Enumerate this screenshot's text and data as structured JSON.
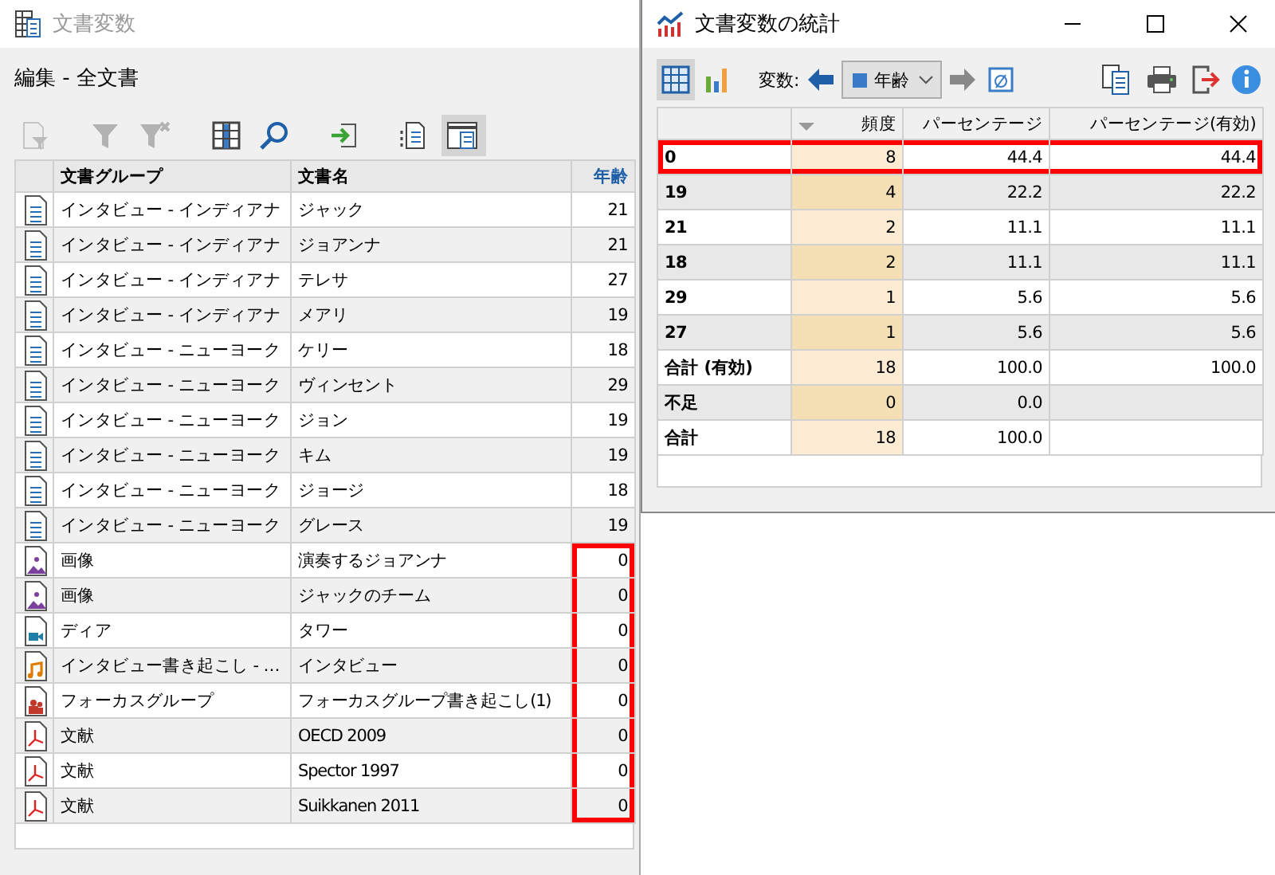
{
  "documents_window": {
    "title": "文書変数",
    "subtitle": "編集 - 全文書",
    "toolbar": [
      {
        "kind": "doc-filter",
        "disabled": true,
        "selected": false
      },
      {
        "kind": "filter",
        "disabled": true,
        "selected": false
      },
      {
        "kind": "filter-clear",
        "disabled": true,
        "selected": false
      },
      {
        "kind": "columns",
        "disabled": false,
        "selected": false
      },
      {
        "kind": "search",
        "disabled": false,
        "selected": false
      },
      {
        "kind": "import",
        "disabled": false,
        "selected": false
      },
      {
        "kind": "doc-list",
        "disabled": false,
        "selected": false
      },
      {
        "kind": "doc-panel",
        "disabled": false,
        "selected": true
      }
    ],
    "table": {
      "columns": [
        "文書グループ",
        "文書名",
        "年齢"
      ],
      "rows": [
        {
          "kind": "text",
          "group": "インタビュー - インディアナ",
          "name": "ジャック",
          "age": "21",
          "age_highlighted": false
        },
        {
          "kind": "text",
          "group": "インタビュー - インディアナ",
          "name": "ジョアンナ",
          "age": "21",
          "age_highlighted": false
        },
        {
          "kind": "text",
          "group": "インタビュー - インディアナ",
          "name": "テレサ",
          "age": "27",
          "age_highlighted": false
        },
        {
          "kind": "text",
          "group": "インタビュー - インディアナ",
          "name": "メアリ",
          "age": "19",
          "age_highlighted": false
        },
        {
          "kind": "text",
          "group": "インタビュー - ニューヨーク",
          "name": "ケリー",
          "age": "18",
          "age_highlighted": false
        },
        {
          "kind": "text",
          "group": "インタビュー - ニューヨーク",
          "name": "ヴィンセント",
          "age": "29",
          "age_highlighted": false
        },
        {
          "kind": "text",
          "group": "インタビュー - ニューヨーク",
          "name": "ジョン",
          "age": "19",
          "age_highlighted": false
        },
        {
          "kind": "text",
          "group": "インタビュー - ニューヨーク",
          "name": "キム",
          "age": "19",
          "age_highlighted": false
        },
        {
          "kind": "text",
          "group": "インタビュー - ニューヨーク",
          "name": "ジョージ",
          "age": "18",
          "age_highlighted": false
        },
        {
          "kind": "text",
          "group": "インタビュー - ニューヨーク",
          "name": "グレース",
          "age": "19",
          "age_highlighted": false
        },
        {
          "kind": "image",
          "group": "画像",
          "name": "演奏するジョアンナ",
          "age": "0",
          "age_highlighted": true
        },
        {
          "kind": "image",
          "group": "画像",
          "name": "ジャックのチーム",
          "age": "0",
          "age_highlighted": true
        },
        {
          "kind": "video",
          "group": "ディア",
          "name": "タワー",
          "age": "0",
          "age_highlighted": true
        },
        {
          "kind": "audio",
          "group": "インタビュー書き起こし - …",
          "name": "インタビュー",
          "age": "0",
          "age_highlighted": true
        },
        {
          "kind": "focus",
          "group": "フォーカスグループ",
          "name": "フォーカスグループ書き起こし(1)",
          "age": "0",
          "age_highlighted": true
        },
        {
          "kind": "pdf",
          "group": "文献",
          "name": "OECD 2009",
          "age": "0",
          "age_highlighted": true
        },
        {
          "kind": "pdf",
          "group": "文献",
          "name": "Spector 1997",
          "age": "0",
          "age_highlighted": true
        },
        {
          "kind": "pdf",
          "group": "文献",
          "name": "Suikkanen 2011",
          "age": "0",
          "age_highlighted": true
        }
      ]
    }
  },
  "statistics_window": {
    "title": "文書変数の統計",
    "view_buttons": [
      {
        "kind": "table",
        "selected": true
      },
      {
        "kind": "chart",
        "selected": false
      }
    ],
    "variable_label": "変数:",
    "variable_value": "年齢",
    "actions": [
      {
        "kind": "copy"
      },
      {
        "kind": "print"
      },
      {
        "kind": "export"
      },
      {
        "kind": "info"
      }
    ],
    "table": {
      "columns": [
        "頻度",
        "パーセンテージ",
        "パーセンテージ(有効)"
      ],
      "rows": [
        {
          "label": "0",
          "frequency": "8",
          "percent": "44.4",
          "valid_percent": "44.4",
          "highlighted": true
        },
        {
          "label": "19",
          "frequency": "4",
          "percent": "22.2",
          "valid_percent": "22.2",
          "highlighted": false
        },
        {
          "label": "21",
          "frequency": "2",
          "percent": "11.1",
          "valid_percent": "11.1",
          "highlighted": false
        },
        {
          "label": "18",
          "frequency": "2",
          "percent": "11.1",
          "valid_percent": "11.1",
          "highlighted": false
        },
        {
          "label": "29",
          "frequency": "1",
          "percent": "5.6",
          "valid_percent": "5.6",
          "highlighted": false
        },
        {
          "label": "27",
          "frequency": "1",
          "percent": "5.6",
          "valid_percent": "5.6",
          "highlighted": false
        },
        {
          "label": "合計 (有効)",
          "frequency": "18",
          "percent": "100.0",
          "valid_percent": "100.0",
          "highlighted": false
        },
        {
          "label": "不足",
          "frequency": "0",
          "percent": "0.0",
          "highlighted": false
        },
        {
          "label": "合計",
          "frequency": "18",
          "percent": "100.0",
          "highlighted": false
        }
      ]
    }
  }
}
